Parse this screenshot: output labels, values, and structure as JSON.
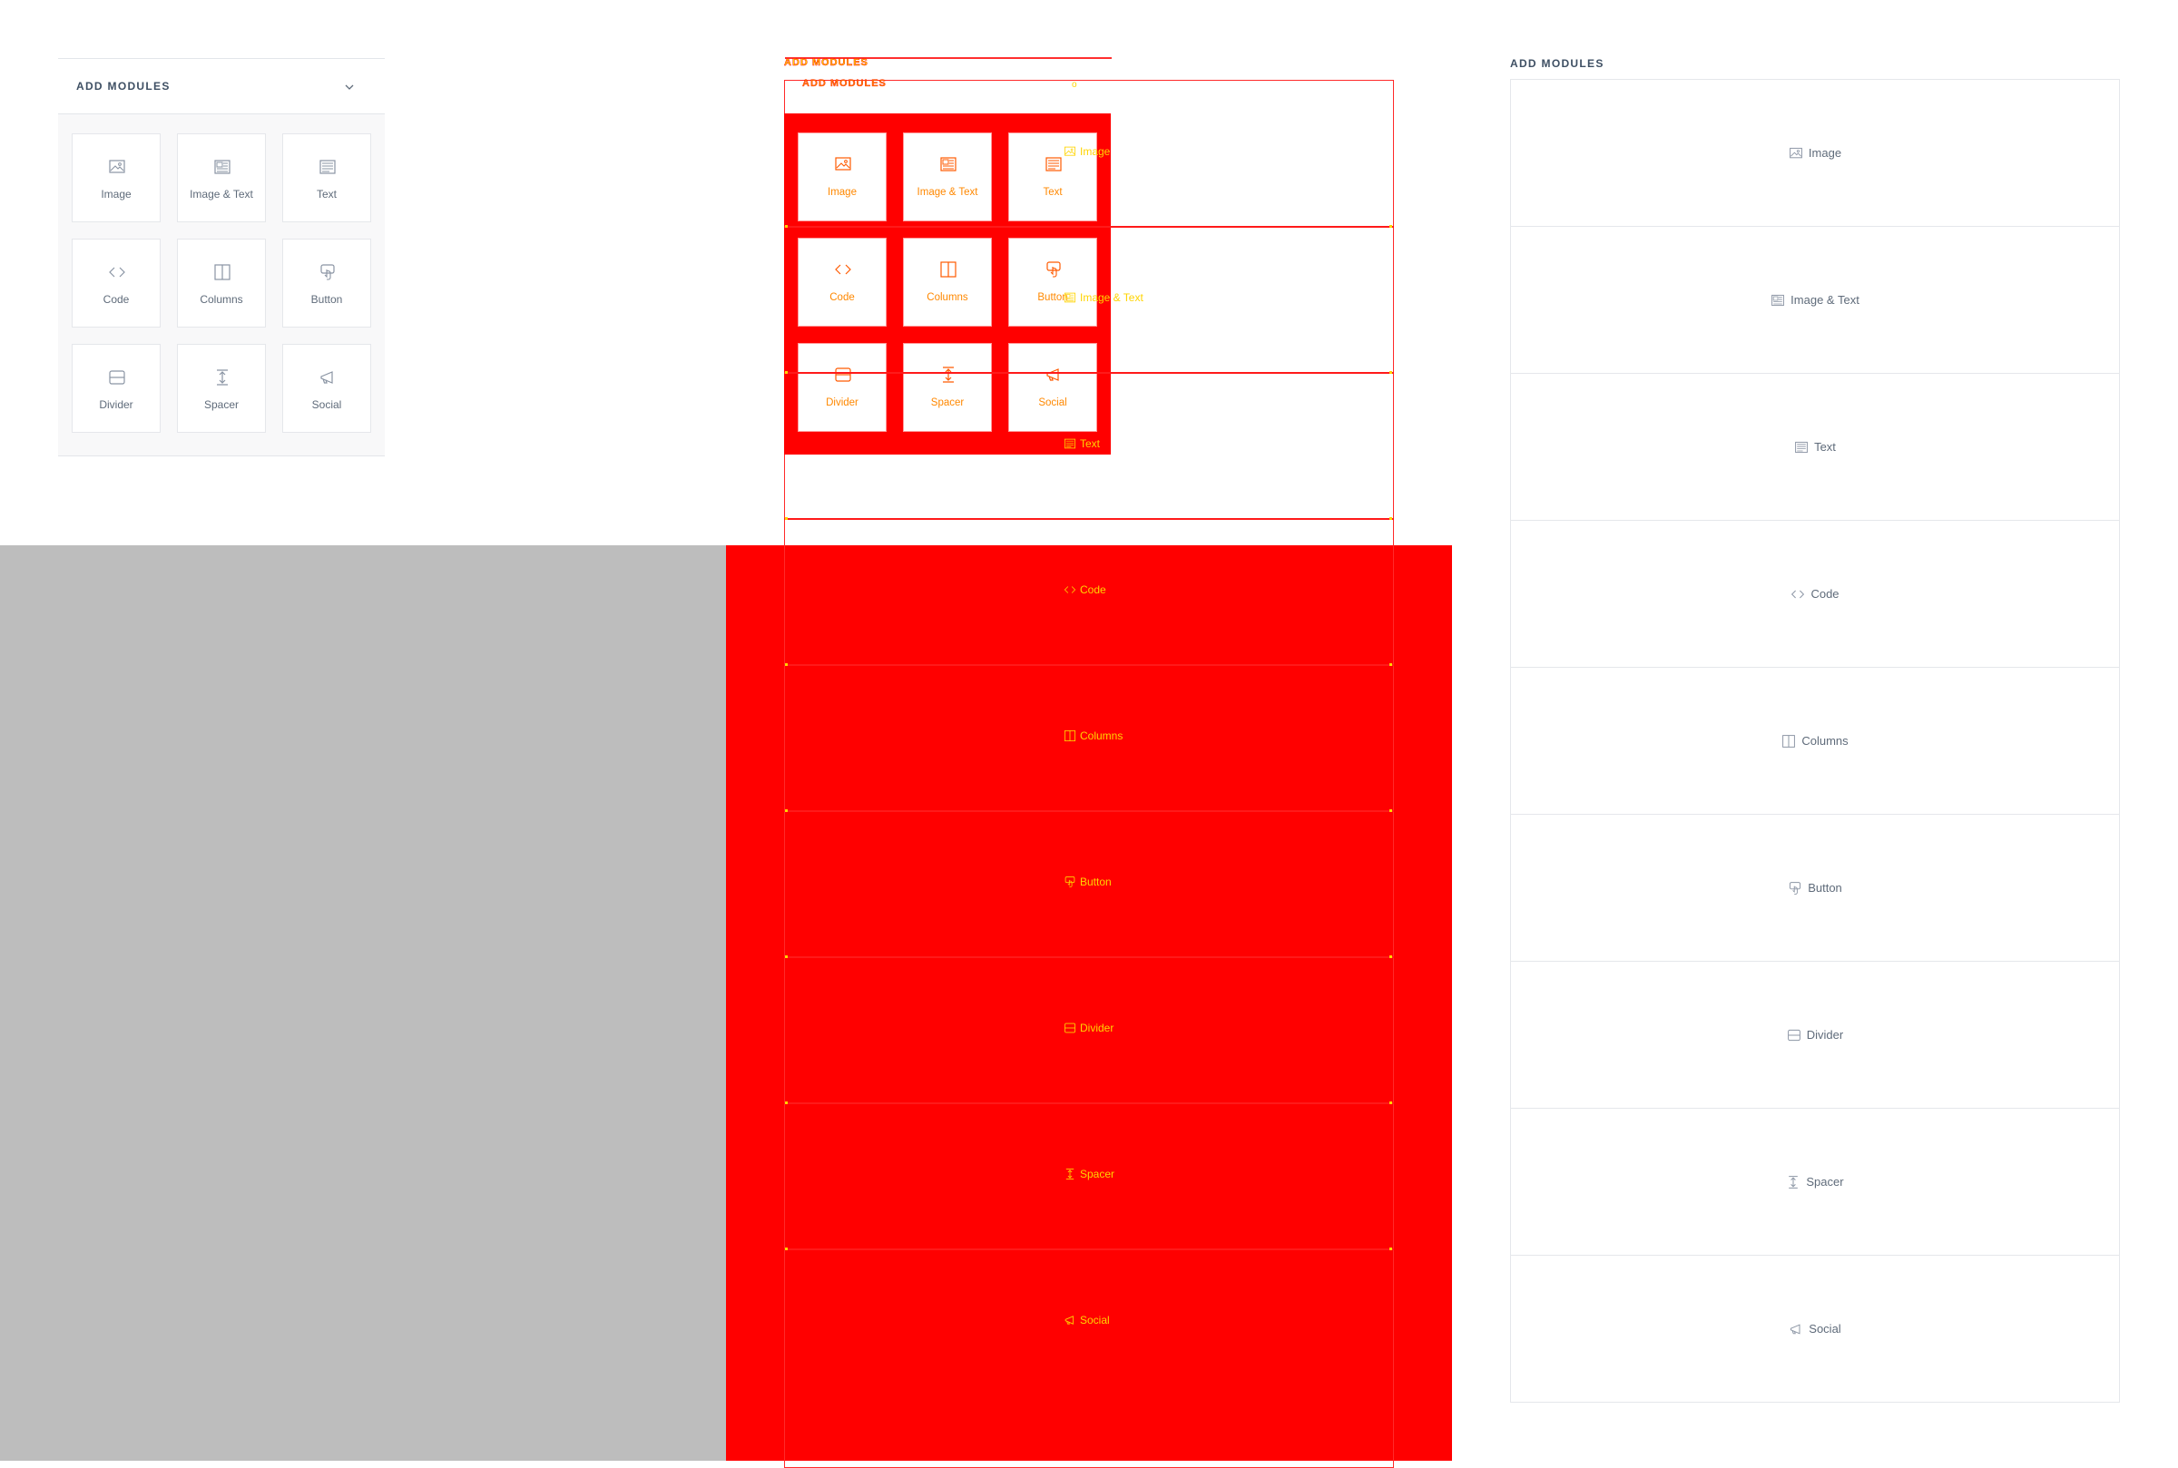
{
  "colors": {
    "text": "#5f6b7a",
    "title": "#3e4f63",
    "border": "#e5e7eb",
    "debug_red": "#ff0000",
    "debug_yellow": "#ffd400",
    "grey": "#bdbdbd"
  },
  "panel_grid": {
    "title": "ADD MODULES",
    "toggle_icon": "chevron-down-icon",
    "tiles": [
      {
        "label": "Image",
        "icon": "image-icon"
      },
      {
        "label": "Image & Text",
        "icon": "image-text-icon"
      },
      {
        "label": "Text",
        "icon": "text-icon"
      },
      {
        "label": "Code",
        "icon": "code-icon"
      },
      {
        "label": "Columns",
        "icon": "columns-icon"
      },
      {
        "label": "Button",
        "icon": "button-icon"
      },
      {
        "label": "Divider",
        "icon": "divider-icon"
      },
      {
        "label": "Spacer",
        "icon": "spacer-icon"
      },
      {
        "label": "Social",
        "icon": "social-icon"
      }
    ]
  },
  "panel_debug": {
    "title": "ADD MODULES",
    "sub_title": "ADD MODULES",
    "tiles": [
      "Image",
      "Image & Text",
      "Text",
      "Code",
      "Columns",
      "Button",
      "Divider",
      "Spacer",
      "Social"
    ],
    "rows": [
      "Image",
      "Image & Text",
      "Text",
      "Code",
      "Columns",
      "Button",
      "Divider",
      "Spacer",
      "Social"
    ]
  },
  "panel_list": {
    "title": "ADD MODULES",
    "items": [
      {
        "label": "Image",
        "icon": "image-icon"
      },
      {
        "label": "Image & Text",
        "icon": "image-text-icon"
      },
      {
        "label": "Text",
        "icon": "text-icon"
      },
      {
        "label": "Code",
        "icon": "code-icon"
      },
      {
        "label": "Columns",
        "icon": "columns-icon"
      },
      {
        "label": "Button",
        "icon": "button-icon"
      },
      {
        "label": "Divider",
        "icon": "divider-icon"
      },
      {
        "label": "Spacer",
        "icon": "spacer-icon"
      },
      {
        "label": "Social",
        "icon": "social-icon"
      }
    ]
  }
}
